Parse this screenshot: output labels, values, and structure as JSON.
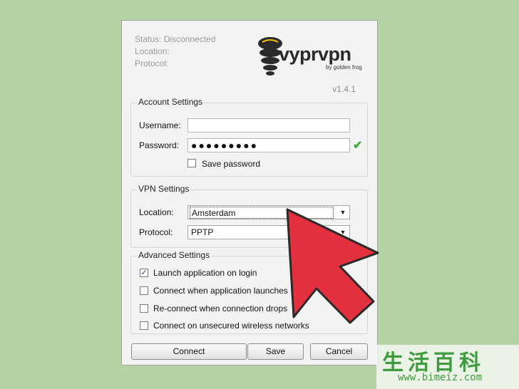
{
  "status": {
    "status_label": "Status: Disconnected",
    "location_label": "Location:",
    "protocol_label": "Protocol:"
  },
  "brand": {
    "name": "vyprvpn",
    "tagline": "by golden frog",
    "version": "v1.4.1"
  },
  "account": {
    "title": "Account Settings",
    "username_label": "Username:",
    "username_value": "",
    "password_label": "Password:",
    "password_value": "●●●●●●●●●",
    "save_password_label": "Save password"
  },
  "vpn": {
    "title": "VPN Settings",
    "location_label": "Location:",
    "location_value": "Amsterdam",
    "protocol_label": "Protocol:",
    "protocol_value": "PPTP"
  },
  "advanced": {
    "title": "Advanced Settings",
    "options": [
      {
        "label": "Launch application on login",
        "checked": true
      },
      {
        "label": "Connect when application launches",
        "checked": false
      },
      {
        "label": "Re-connect when connection drops",
        "checked": false
      },
      {
        "label": "Connect on unsecured wireless networks",
        "checked": false
      }
    ]
  },
  "buttons": {
    "connect": "Connect",
    "save": "Save",
    "cancel": "Cancel"
  },
  "watermark": {
    "chinese": "生活百科",
    "url": "www.bimeiz.com"
  },
  "colors": {
    "background": "#b5d3a5",
    "arrow": "#e2303f",
    "check": "#3cae3c"
  },
  "icons": [
    "vyprvpn-logo-icon",
    "checkmark-icon",
    "dropdown-arrow-icon",
    "pointer-arrow-icon"
  ]
}
